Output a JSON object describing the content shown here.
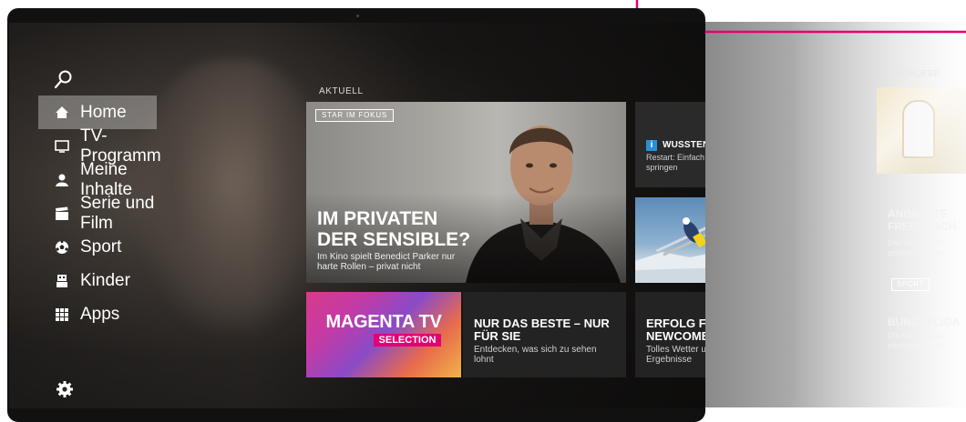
{
  "next_panel": {
    "section_label": "NACHLESE",
    "title": "ANIMIERTE FREUNDSCH",
    "subtitle": "Der neue Anim endlich im Fern",
    "badge": "SPORT",
    "title2": "BUNDESLIGA",
    "subtitle2": "Die Vorschau a nächsten Spiel"
  },
  "sidebar": {
    "items": [
      {
        "label": "Home",
        "icon": "home-icon",
        "active": true
      },
      {
        "label": "TV-Programm",
        "icon": "tv-icon"
      },
      {
        "label": "Meine Inhalte",
        "icon": "user-icon"
      },
      {
        "label": "Serie und Film",
        "icon": "clapperboard-icon"
      },
      {
        "label": "Sport",
        "icon": "soccer-ball-icon"
      },
      {
        "label": "Kinder",
        "icon": "kids-icon"
      },
      {
        "label": "Apps",
        "icon": "apps-grid-icon"
      }
    ]
  },
  "main": {
    "section_label": "AKTUELL",
    "hero": {
      "tag": "STAR IM FOKUS",
      "title": "IM PRIVATEN DER SENSIBLE?",
      "subtitle": "Im Kino spielt Benedict Parker nur harte Rollen – privat nicht"
    },
    "wissen": {
      "title": "WUSSTEN SIE SCHON?",
      "subtitle": "Restart: Einfach zurück zum Anfang springen"
    },
    "magenta": {
      "title": "MAGENTA TV",
      "badge": "SELECTION"
    },
    "beste": {
      "title": "NUR DAS BESTE – NUR FÜR SIE",
      "subtitle": "Entdecken, was sich zu sehen lohnt"
    },
    "newcomer": {
      "title": "ERFOLG FÜR DIE NEWCOMER",
      "subtitle": "Tolles Wetter und überraschende Ergebnisse"
    }
  },
  "colors": {
    "magenta": "#e20074",
    "info_blue": "#2a8fd6"
  }
}
